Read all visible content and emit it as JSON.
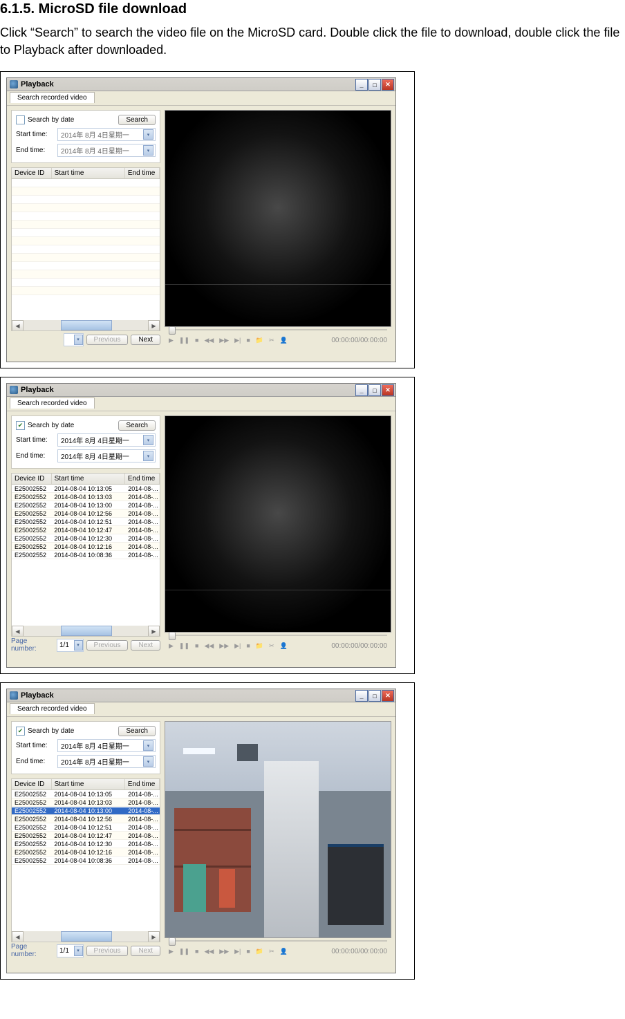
{
  "heading": "6.1.5.  MicroSD file download",
  "body_text": "Click “Search” to search the video file on the MicroSD card. Double click the file to download, double click the file to Playback after downloaded.",
  "common": {
    "app_title": "Playback",
    "tab_label": "Search recorded video",
    "search_by_date": "Search by date",
    "search_btn": "Search",
    "start_time": "Start time:",
    "end_time": "End time:",
    "date_grey": "2014年  8月  4日星期一",
    "date_active": "2014年  8月  4日星期一",
    "col_device": "Device ID",
    "col_start": "Start time",
    "col_end": "End time",
    "page_number": "Page number:",
    "page_value": "1/1",
    "prev": "Previous",
    "next": "Next",
    "time_label": "00:00:00/00:00:00",
    "win_min": "_",
    "win_max": "□",
    "win_close": "✕",
    "dropdown_glyph": "▾",
    "check_glyph": "✔",
    "scroll_left": "◀",
    "scroll_right": "▶",
    "ctrl_play": "▶",
    "ctrl_pause": "❚❚",
    "ctrl_stop": "■",
    "ctrl_rew": "◀◀",
    "ctrl_ff": "▶▶",
    "ctrl_next": "▶|",
    "ctrl_rec": "■",
    "ctrl_folder": "📁",
    "ctrl_cut": "✂",
    "ctrl_user": "👤"
  },
  "results": [
    {
      "id": "E25002552",
      "start": "2014-08-04 10:13:05",
      "end": "2014-08-..."
    },
    {
      "id": "E25002552",
      "start": "2014-08-04 10:13:03",
      "end": "2014-08-..."
    },
    {
      "id": "E25002552",
      "start": "2014-08-04 10:13:00",
      "end": "2014-08-..."
    },
    {
      "id": "E25002552",
      "start": "2014-08-04 10:12:56",
      "end": "2014-08-..."
    },
    {
      "id": "E25002552",
      "start": "2014-08-04 10:12:51",
      "end": "2014-08-..."
    },
    {
      "id": "E25002552",
      "start": "2014-08-04 10:12:47",
      "end": "2014-08-..."
    },
    {
      "id": "E25002552",
      "start": "2014-08-04 10:12:30",
      "end": "2014-08-..."
    },
    {
      "id": "E25002552",
      "start": "2014-08-04 10:12:16",
      "end": "2014-08-..."
    },
    {
      "id": "E25002552",
      "start": "2014-08-04 10:08:36",
      "end": "2014-08-..."
    }
  ],
  "shots": {
    "s1": {
      "checked": false,
      "date_active": false,
      "has_results": false,
      "has_page": false,
      "selected_row": -1,
      "video_mode": "dark"
    },
    "s2": {
      "checked": true,
      "date_active": true,
      "has_results": true,
      "has_page": true,
      "selected_row": -1,
      "video_mode": "dark"
    },
    "s3": {
      "checked": true,
      "date_active": true,
      "has_results": true,
      "has_page": true,
      "selected_row": 2,
      "video_mode": "photo"
    }
  }
}
